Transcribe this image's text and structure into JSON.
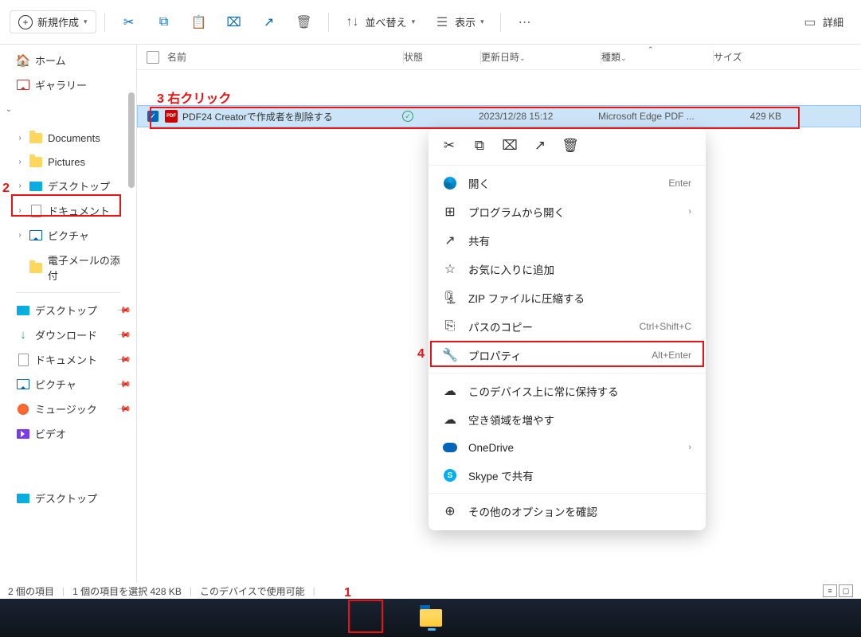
{
  "toolbar": {
    "new_label": "新規作成",
    "sort_label": "並べ替え",
    "view_label": "表示",
    "details_label": "詳細"
  },
  "sidebar": {
    "home": "ホーム",
    "gallery": "ギャラリー",
    "documents": "Documents",
    "pictures": "Pictures",
    "desktop": "デスクトップ",
    "documents_jp": "ドキュメント",
    "pictures_jp": "ピクチャ",
    "email_attach": "電子メールの添付",
    "desktop2": "デスクトップ",
    "downloads": "ダウンロード",
    "documents2": "ドキュメント",
    "pictures2": "ピクチャ",
    "music": "ミュージック",
    "video": "ビデオ",
    "desktop3": "デスクトップ"
  },
  "columns": {
    "name": "名前",
    "state": "状態",
    "date": "更新日時",
    "type": "種類",
    "size": "サイズ"
  },
  "file": {
    "name": "PDF24 Creatorで作成者を削除する",
    "date": "2023/12/28 15:12",
    "type": "Microsoft Edge PDF ...",
    "size": "429 KB"
  },
  "context_menu": {
    "open": "開く",
    "open_shortcut": "Enter",
    "open_with": "プログラムから開く",
    "share": "共有",
    "favorite": "お気に入りに追加",
    "zip": "ZIP ファイルに圧縮する",
    "copy_path": "パスのコピー",
    "copy_path_shortcut": "Ctrl+Shift+C",
    "properties": "プロパティ",
    "properties_shortcut": "Alt+Enter",
    "keep_device": "このデバイス上に常に保持する",
    "free_space": "空き領域を増やす",
    "onedrive": "OneDrive",
    "skype": "Skype で共有",
    "more": "その他のオプションを確認"
  },
  "status": {
    "count": "2 個の項目",
    "selected": "1 個の項目を選択 428 KB",
    "available": "このデバイスで使用可能"
  },
  "annotations": {
    "a1": "1",
    "a2": "2",
    "a3": "3 右クリック",
    "a4": "4"
  }
}
